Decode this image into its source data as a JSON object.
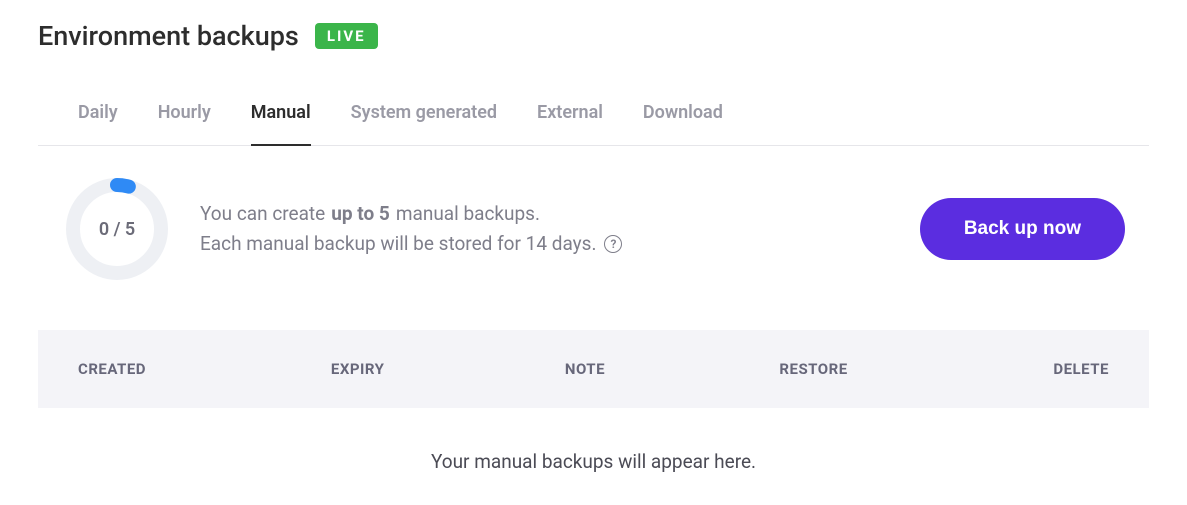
{
  "header": {
    "title": "Environment backups",
    "badge": "LIVE"
  },
  "tabs": {
    "items": [
      {
        "label": "Daily"
      },
      {
        "label": "Hourly"
      },
      {
        "label": "Manual"
      },
      {
        "label": "System generated"
      },
      {
        "label": "External"
      },
      {
        "label": "Download"
      }
    ]
  },
  "gauge": {
    "used": 0,
    "total": 5,
    "display": "0 / 5"
  },
  "info": {
    "line1a": "You can create ",
    "line1b": "up to 5",
    "line1c": " manual backups.",
    "line2": "Each manual backup will be stored for 14 days."
  },
  "actions": {
    "backup_now": "Back up now"
  },
  "table": {
    "columns": {
      "created": "CREATED",
      "expiry": "EXPIRY",
      "note": "NOTE",
      "restore": "RESTORE",
      "delete": "DELETE"
    },
    "empty_message": "Your manual backups will appear here."
  },
  "colors": {
    "accent": "#5b2de0",
    "badge": "#3bb54a"
  }
}
